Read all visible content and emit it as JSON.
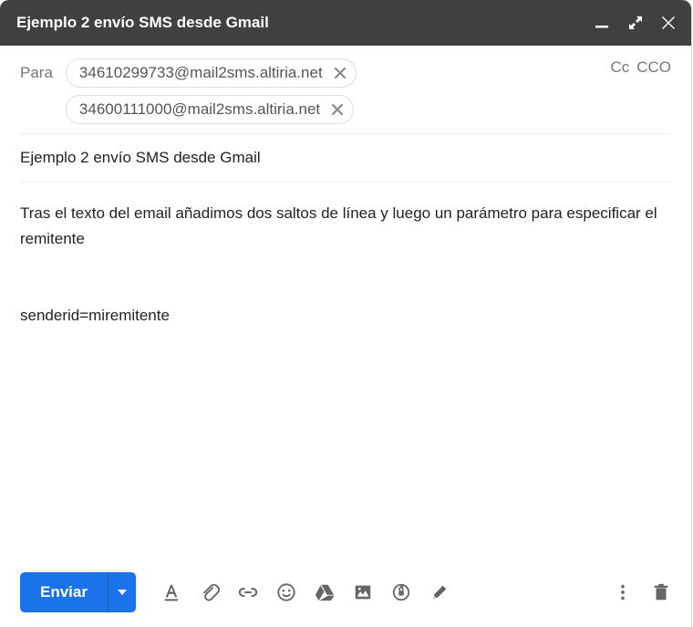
{
  "titlebar": {
    "title": "Ejemplo 2 envío SMS desde Gmail"
  },
  "recipients": {
    "to_label": "Para",
    "chips": [
      "34610299733@mail2sms.altiria.net",
      "34600111000@mail2sms.altiria.net"
    ],
    "cc_label": "Cc",
    "bcc_label": "CCO"
  },
  "subject": "Ejemplo 2 envío SMS desde Gmail",
  "body": {
    "para1": "Tras el texto del email añadimos dos saltos de línea y luego un parámetro para especificar el remitente",
    "para2": "senderid=miremitente"
  },
  "toolbar": {
    "send_label": "Enviar"
  }
}
